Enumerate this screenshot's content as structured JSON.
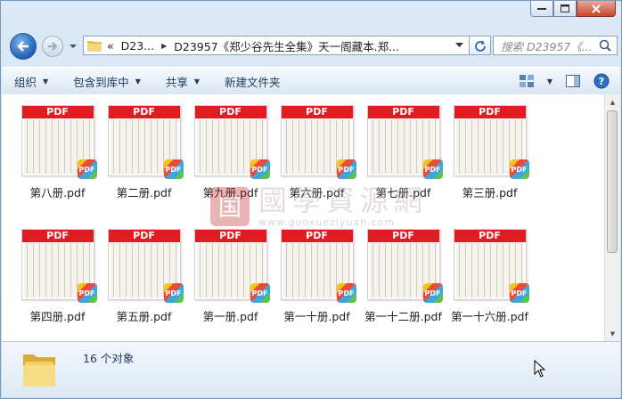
{
  "nav": {
    "back_icon": "back-arrow-icon",
    "forward_icon": "forward-arrow-icon"
  },
  "address": {
    "overflow": "«",
    "crumbs": [
      "D23...",
      "D23957《郑少谷先生全集》天一阁藏本.郑..."
    ]
  },
  "search": {
    "placeholder": "搜索 D23957《..."
  },
  "toolbar": {
    "organize": "组织",
    "include_library": "包含到库中",
    "share": "共享",
    "new_folder": "新建文件夹"
  },
  "files": [
    {
      "name": "第八册.pdf",
      "badge": "PDF",
      "label": "PDF"
    },
    {
      "name": "第二册.pdf",
      "badge": "PDF",
      "label": "PDF"
    },
    {
      "name": "第九册.pdf",
      "badge": "PDF",
      "label": "PDF"
    },
    {
      "name": "第六册.pdf",
      "badge": "PDF",
      "label": "PDF"
    },
    {
      "name": "第七册.pdf",
      "badge": "PDF",
      "label": "PDF"
    },
    {
      "name": "第三册.pdf",
      "badge": "PDF",
      "label": "PDF"
    },
    {
      "name": "第四册.pdf",
      "badge": "PDF",
      "label": "PDF"
    },
    {
      "name": "第五册.pdf",
      "badge": "PDF",
      "label": "PDF"
    },
    {
      "name": "第一册.pdf",
      "badge": "PDF",
      "label": "PDF"
    },
    {
      "name": "第一十册.pdf",
      "badge": "PDF",
      "label": "PDF"
    },
    {
      "name": "第一十二册.pdf",
      "badge": "PDF",
      "label": "PDF"
    },
    {
      "name": "第一十六册.pdf",
      "badge": "PDF",
      "label": "PDF"
    }
  ],
  "watermark": {
    "seal": "国",
    "title": "國學資源網",
    "url": "www.guoxueziyuan.com"
  },
  "status": {
    "count": "16 个对象"
  },
  "colors": {
    "pdf_red": "#e01b22",
    "toolbar_text": "#1e395b"
  }
}
